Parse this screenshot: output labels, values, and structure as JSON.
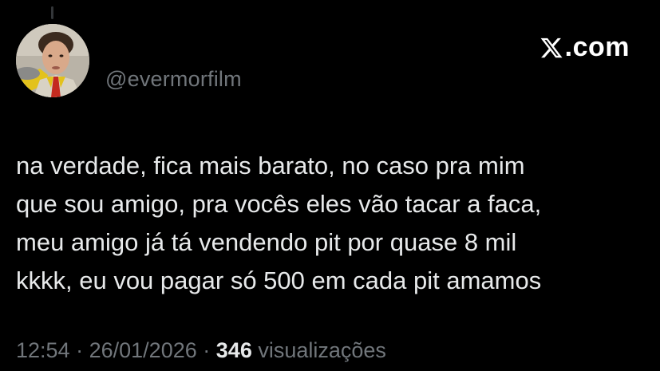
{
  "user": {
    "handle": "@evermorfilm"
  },
  "brand": {
    "icon": "x-logo-icon",
    "text": ".com"
  },
  "tweet": {
    "lines": [
      "na verdade, fica mais barato, no caso pra mim",
      "que sou amigo, pra vocês eles vão tacar a faca,",
      "meu amigo já tá vendendo pit por quase 8 mil",
      "kkkk, eu vou pagar só 500 em cada pit amamos"
    ]
  },
  "meta": {
    "time": "12:54",
    "separator": "·",
    "date": "26/01/2026",
    "views_count": "346",
    "views_label": "visualizações"
  },
  "colors": {
    "background": "#000000",
    "text": "#e7e9ea",
    "muted": "#71767b"
  }
}
